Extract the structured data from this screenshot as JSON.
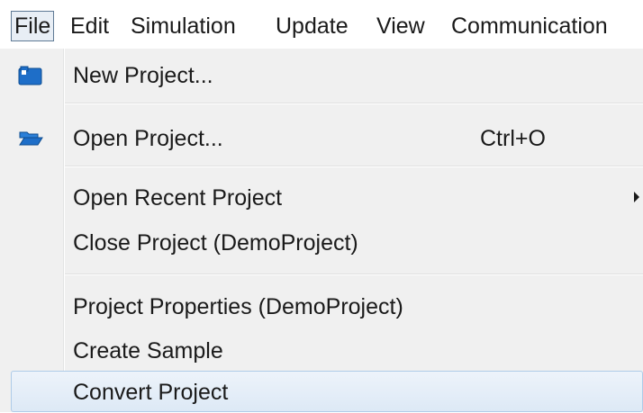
{
  "menubar": {
    "items": [
      {
        "label": "File"
      },
      {
        "label": "Edit"
      },
      {
        "label": "Simulation"
      },
      {
        "label": "Update"
      },
      {
        "label": "View"
      },
      {
        "label": "Communication"
      }
    ]
  },
  "file_menu": {
    "items": [
      {
        "label": "New Project...",
        "icon": "new-project-icon"
      },
      {
        "label": "Open Project...",
        "icon": "folder-open-icon",
        "shortcut": "Ctrl+O"
      },
      {
        "label": "Open Recent Project",
        "submenu": true
      },
      {
        "label": "Close Project (DemoProject)"
      },
      {
        "label": "Project Properties (DemoProject)"
      },
      {
        "label": "Create Sample"
      },
      {
        "label": "Convert Project",
        "highlighted": true
      }
    ]
  },
  "colors": {
    "menu_background": "#f0f0f0",
    "highlight_border": "#aecbe8",
    "highlight_fill": "#dde9f6",
    "icon_blue": "#1e6ec8"
  }
}
